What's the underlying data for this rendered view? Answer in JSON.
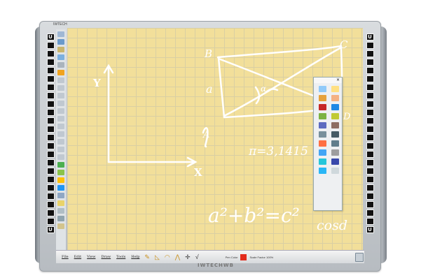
{
  "app": {
    "title_text": "IWTECH",
    "brand": "IWTECHWB"
  },
  "menu": {
    "file": "File",
    "edit": "Edit",
    "view": "View",
    "draw": "Draw",
    "tools": "Tools",
    "help": "Help"
  },
  "status": {
    "pen_color_label": "Pen Color",
    "pen_color": "#e22b1c",
    "scale_label": "Scale Factor 100%"
  },
  "board": {
    "background": "#f2df9a",
    "axis_y": "Y",
    "axis_x": "X",
    "pi_text": "π=3,1415",
    "formula": "a²+b²=c²",
    "cos_text": "cosd",
    "label_b": "B",
    "label_c": "C",
    "label_a": "a",
    "label_d": "D",
    "label_A": "A",
    "label_alpha": "α"
  },
  "floating_toolbar": {
    "close_glyph": "×",
    "icons": [
      "undo-icon",
      "redo-icon",
      "select-icon",
      "pen-icon",
      "pen-red-icon",
      "pen-blue-icon",
      "marker-icon",
      "highlighter-icon",
      "shape-icon",
      "eraser-icon",
      "text-icon",
      "camera-icon",
      "screen-icon",
      "record-icon",
      "magnifier-icon",
      "spotlight-icon",
      "cursor-icon",
      "keyboard-icon",
      "grid-icon",
      "globe-icon",
      "page-icon"
    ]
  },
  "side_buttons": [
    "U-",
    "⬛",
    "⬛",
    "⬛",
    "⬛",
    "⬛",
    "⬛",
    "⬛",
    "⬛",
    "⬛",
    "⬛",
    "⬛",
    "⬛",
    "⬛",
    "⬛",
    "⬛",
    "⬛",
    "⬛",
    "⬛",
    "⬛",
    "⬛",
    "⬛",
    "⬛",
    "⬛",
    "U-"
  ]
}
